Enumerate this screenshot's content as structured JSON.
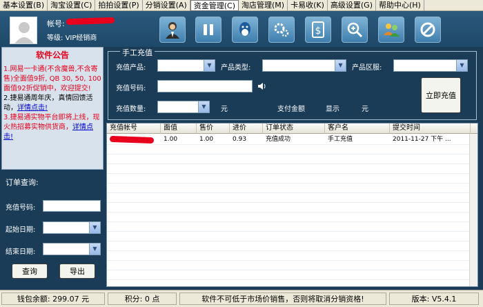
{
  "menu": [
    {
      "label": "基本设置(B)"
    },
    {
      "label": "淘宝设置(C)"
    },
    {
      "label": "拍拍设置(P)"
    },
    {
      "label": "分销设置(A)"
    },
    {
      "label": "资金管理(C)"
    },
    {
      "label": "淘店管理(M)"
    },
    {
      "label": "卡易收(K)"
    },
    {
      "label": "高级设置(G)"
    },
    {
      "label": "帮助中心(H)"
    }
  ],
  "account": {
    "account_label": "帐号:",
    "level_label": "等级:",
    "level_value": "VIP经销商"
  },
  "toolbar": [
    {
      "icon": "agent-icon"
    },
    {
      "icon": "pause-icon"
    },
    {
      "icon": "qq-icon"
    },
    {
      "icon": "settings-icon"
    },
    {
      "icon": "money-icon"
    },
    {
      "icon": "zoom-icon"
    },
    {
      "icon": "users-icon"
    },
    {
      "icon": "forbidden-icon"
    }
  ],
  "notice": {
    "title": "软件公告",
    "item1": "1.网易一卡通(不含魔兽,不含寄售)全面值9折, QB 30, 50, 100面值92折促销中，欢迎提交!",
    "item2_text": "2.捷易通周年庆，真情回馈活动，",
    "item2_link": "详情点击!",
    "item3_text": "3.捷易通实物平台即将上线，现火热招募实物供货商，",
    "item3_link": "详情点击!"
  },
  "order_query": {
    "title": "订单查询:",
    "number_label": "充值号码:",
    "start_label": "起始日期:",
    "end_label": "结束日期:",
    "query_button": "查询",
    "export_button": "导出"
  },
  "recharge": {
    "title": "手工充值",
    "product_label": "充值产品:",
    "type_label": "产品类型:",
    "region_label": "产品区服:",
    "number_label": "充值号码:",
    "quantity_label": "充值数量:",
    "unit1": "元",
    "pay_label": "支付金额",
    "pay_value": "显示",
    "unit2": "元",
    "submit_button": "立即充值"
  },
  "table": {
    "headers": [
      "充值帐号",
      "面值",
      "售价",
      "进价",
      "订单状态",
      "客户名",
      "提交时间"
    ],
    "rows": [
      {
        "face": "1.00",
        "price": "1.00",
        "cost": "0.93",
        "status": "充值成功",
        "customer": "手工充值",
        "time": "2011-11-27 下午 ..."
      }
    ]
  },
  "status": {
    "balance": "钱包余额: 299.07 元",
    "points": "积分: 0 点",
    "warning": "软件不可低于市场价销售，否则将取消分销资格!",
    "version": "版本: V5.4.1"
  },
  "colors": {
    "background": "#1a3c57",
    "notice_red": "#e8001c",
    "link_blue": "#0000cc"
  }
}
